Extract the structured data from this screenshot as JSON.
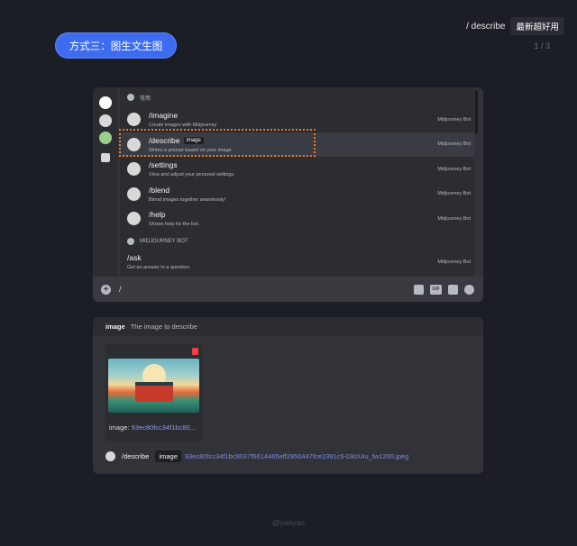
{
  "top_right": {
    "command": "/ describe",
    "tag": "最新超好用"
  },
  "pager": "1 / 3",
  "pill": "方式三：图生文生图",
  "autocomplete": {
    "section_common": "常用",
    "commands": [
      {
        "name": "/imagine",
        "desc": "Create images with Midjourney",
        "source": "Midjourney Bot"
      },
      {
        "name": "/describe",
        "option": "image",
        "desc": "Writes a prompt based on your image.",
        "source": "Midjourney Bot"
      },
      {
        "name": "/settings",
        "desc": "View and adjust your personal settings.",
        "source": "Midjourney Bot"
      },
      {
        "name": "/blend",
        "desc": "Blend images together seamlessly!",
        "source": "Midjourney Bot"
      },
      {
        "name": "/help",
        "desc": "Shows help for the bot.",
        "source": "Midjourney Bot"
      }
    ],
    "section_bot": "MIDJOURNEY BOT",
    "bot_command": {
      "name": "/ask",
      "desc": "Get an answer to a question.",
      "source": "Midjourney Bot"
    }
  },
  "input": {
    "value": "/"
  },
  "input_icons": [
    "gift-icon",
    "gif-icon",
    "sticker-icon",
    "emoji-icon"
  ],
  "gif_label": "GIF",
  "image_panel": {
    "label": "image",
    "hint": "The image to describe",
    "caption_prefix": "image:",
    "caption_file": "93ec80fcc34f1bc80...",
    "command": "/describe",
    "option": "image",
    "filename": "93ec80fcc34f1bc8037f6614465eff2950447fce2391c5-DkIX4u_fw1200.jpeg"
  },
  "footer": "@yaoyao",
  "colors": {
    "accent": "#3d6cf0",
    "highlight_border": "#e8762c",
    "link": "#7e8bdb"
  }
}
